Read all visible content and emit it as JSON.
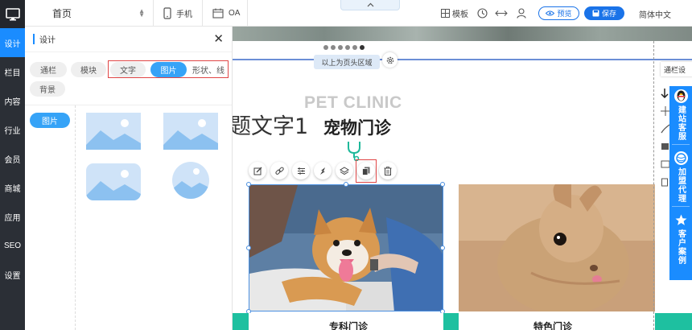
{
  "left_nav": {
    "items": [
      {
        "label": "设计",
        "active": true
      },
      {
        "label": "栏目"
      },
      {
        "label": "内容"
      },
      {
        "label": "行业"
      },
      {
        "label": "会员"
      },
      {
        "label": "商城"
      },
      {
        "label": "应用"
      },
      {
        "label": "SEO"
      },
      {
        "label": "设置"
      }
    ]
  },
  "topbar": {
    "page_select": "首页",
    "mobile_label": "手机",
    "oa_label": "OA",
    "template_label": "模板",
    "preview_label": "预览",
    "save_label": "保存",
    "language": "简体中文"
  },
  "panel": {
    "title": "设计",
    "tabs_row1": [
      "通栏",
      "模块"
    ],
    "tabs_group": [
      "文字",
      "图片",
      "形状、线"
    ],
    "tabs_row2": [
      "背景"
    ],
    "active_tab": "图片",
    "category": "图片"
  },
  "canvas": {
    "header_tip": "以上为页头区域",
    "subtitle_en": "PET CLINIC",
    "title_cut": "题文字1",
    "title_cn": "宠物门诊",
    "cards": [
      {
        "title": "专科门诊"
      },
      {
        "title": "特色门诊"
      }
    ],
    "right_tag": "通栏设"
  },
  "service": {
    "items": [
      "建站客服",
      "加盟代理",
      "客户案例"
    ]
  },
  "colors": {
    "accent": "#1a8cff",
    "nav_bg": "#2b2f36",
    "teal": "#1ec0a0",
    "highlight_border": "#e04646"
  }
}
